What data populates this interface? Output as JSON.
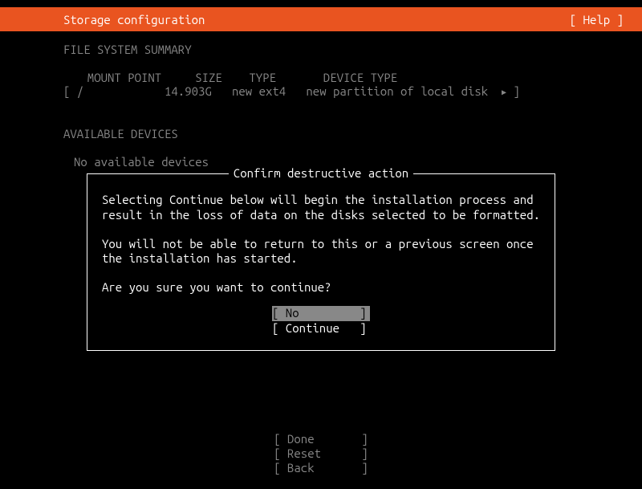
{
  "header": {
    "title": "Storage configuration",
    "help": "[ Help ]"
  },
  "filesystem": {
    "heading": "FILE SYSTEM SUMMARY",
    "cols": "  MOUNT POINT     SIZE    TYPE       DEVICE TYPE",
    "row": "[ /            14.903G   new ext4   new partition of local disk  ",
    "rowEnd": " ]"
  },
  "devices": {
    "heading": "AVAILABLE DEVICES",
    "empty": "No available devices"
  },
  "dialog": {
    "title": "Confirm destructive action",
    "p1": "Selecting Continue below will begin the installation process and result in the loss of data on the disks selected to be formatted.",
    "p2": "You will not be able to return to this or a previous screen once the installation has started.",
    "p3": "Are you sure you want to continue?",
    "no": "[ No         ]",
    "cont": "[ Continue   ]"
  },
  "footer": {
    "done": "[ Done       ]",
    "reset": "[ Reset      ]",
    "back": "[ Back       ]"
  }
}
